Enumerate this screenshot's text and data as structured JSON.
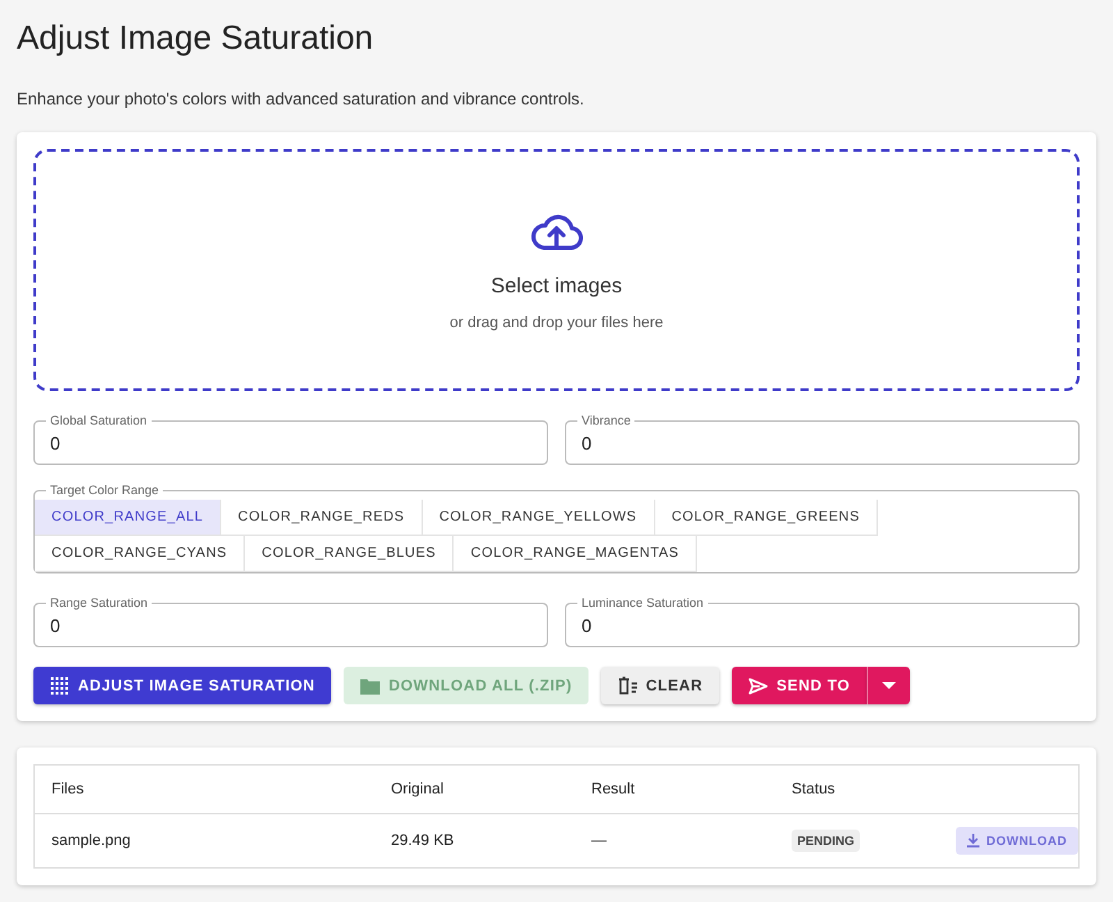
{
  "title": "Adjust Image Saturation",
  "subtitle": "Enhance your photo's colors with advanced saturation and vibrance controls.",
  "dropzone": {
    "title": "Select images",
    "hint": "or drag and drop your files here"
  },
  "fields_top": [
    {
      "label": "Global Saturation",
      "value": "0"
    },
    {
      "label": "Vibrance",
      "value": "0"
    }
  ],
  "color_range": {
    "label": "Target Color Range",
    "options": [
      {
        "label": "COLOR_RANGE_ALL",
        "selected": true
      },
      {
        "label": "COLOR_RANGE_REDS",
        "selected": false
      },
      {
        "label": "COLOR_RANGE_YELLOWS",
        "selected": false
      },
      {
        "label": "COLOR_RANGE_GREENS",
        "selected": false
      },
      {
        "label": "COLOR_RANGE_CYANS",
        "selected": false
      },
      {
        "label": "COLOR_RANGE_BLUES",
        "selected": false
      },
      {
        "label": "COLOR_RANGE_MAGENTAS",
        "selected": false
      }
    ]
  },
  "fields_bottom": [
    {
      "label": "Range Saturation",
      "value": "0"
    },
    {
      "label": "Luminance Saturation",
      "value": "0"
    }
  ],
  "actions": [
    {
      "kind": "primary",
      "label": "ADJUST IMAGE SATURATION",
      "disabled": false
    },
    {
      "kind": "download",
      "label": "DOWNLOAD ALL (.ZIP)",
      "disabled": true
    },
    {
      "kind": "clear",
      "label": "CLEAR",
      "disabled": false
    },
    {
      "kind": "send",
      "label": "SEND TO",
      "disabled": false
    }
  ],
  "table": {
    "columns": [
      "Files",
      "Original",
      "Result",
      "Status"
    ],
    "rows": [
      {
        "file": "sample.png",
        "original": "29.49 KB",
        "result": "—",
        "status": "PENDING",
        "action": "DOWNLOAD",
        "action_disabled": true
      }
    ]
  }
}
